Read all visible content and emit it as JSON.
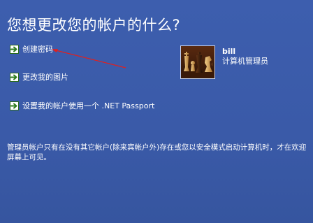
{
  "page": {
    "title": "您想更改您的帐户的什么?"
  },
  "tasks": [
    {
      "label": "创建密码",
      "icon": "arrow-right-icon"
    },
    {
      "label": "更改我的图片",
      "icon": "arrow-right-icon"
    },
    {
      "label": "设置我的帐户使用一个 .NET Passport",
      "icon": "arrow-right-icon"
    }
  ],
  "user": {
    "name": "bill",
    "role": "计算机管理员",
    "picture": "chess-pieces"
  },
  "note": "管理员帐户只有在没有其它帐户(除来宾帐户外)存在或您以安全模式启动计算机时，才在欢迎屏幕上可见。",
  "colors": {
    "background": "#3a5aa8",
    "arrow_icon": "#2e7d1e",
    "annotation_arrow": "#e02020"
  }
}
